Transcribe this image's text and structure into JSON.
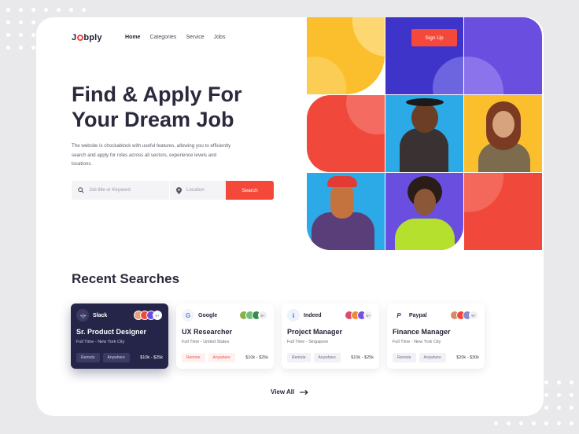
{
  "brand": {
    "logo_pre": "J",
    "logo_post": "bply",
    "accent": "#f4483b",
    "dark": "#25254a"
  },
  "nav": {
    "items": [
      "Home",
      "Categories",
      "Service",
      "Jobs"
    ],
    "active": "Home"
  },
  "header": {
    "signup_label": "Sign Up"
  },
  "hero": {
    "title_line1": "Find & Apply For",
    "title_line2": "Your Dream Job",
    "description": "The website is chockablock with useful features, allowing you to efficiently search and apply for roles across all sectors, experience levels and locations."
  },
  "search": {
    "keyword_placeholder": "Job title or Keyword",
    "location_placeholder": "Location",
    "button_label": "Search"
  },
  "recent": {
    "title": "Recent Searches",
    "view_all": "View All",
    "jobs": [
      {
        "company": "Slack",
        "title": "Sr. Product Designer",
        "meta": "Full Time - New York City",
        "tags": [
          "Remote",
          "Anywhere"
        ],
        "salary": "$10k - $25k",
        "more": "5+"
      },
      {
        "company": "Google",
        "title": "UX Researcher",
        "meta": "Full Time - United States",
        "tags": [
          "Remote",
          "Anywhere"
        ],
        "salary": "$10k - $25k",
        "more": "5+"
      },
      {
        "company": "Indeed",
        "title": "Project Manager",
        "meta": "Full Time - Singapore",
        "tags": [
          "Remote",
          "Anywhere"
        ],
        "salary": "$10k - $25k",
        "more": "5+"
      },
      {
        "company": "Paypal",
        "title": "Finance Manager",
        "meta": "Full Time - New York City",
        "tags": [
          "Remote",
          "Anywhere"
        ],
        "salary": "$20k - $30k",
        "more": "5+"
      }
    ]
  },
  "icons": [
    "search-icon",
    "location-pin-icon",
    "arrow-right-icon"
  ]
}
